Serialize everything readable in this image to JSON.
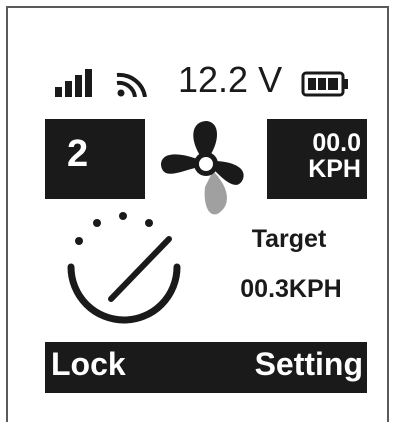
{
  "status_bar": {
    "voltage": "12.2 V",
    "signal_icon": "signal-bars-icon",
    "wifi_icon": "wifi-icon",
    "battery_icon": "battery-full-icon"
  },
  "gear": {
    "value": "2"
  },
  "fan": {
    "icon": "fan-icon"
  },
  "speed": {
    "value": "00.0",
    "unit": "KPH"
  },
  "dial": {
    "icon": "dial-icon"
  },
  "target": {
    "label": "Target",
    "value": "00.3KPH"
  },
  "softkeys": {
    "left_label": "Lock",
    "right_label": "Setting"
  },
  "colors": {
    "screen_bg": "#ffffff",
    "ink": "#1a1a1a",
    "accent_gray": "#a0a0a0",
    "frame": "#5a5a5a"
  }
}
